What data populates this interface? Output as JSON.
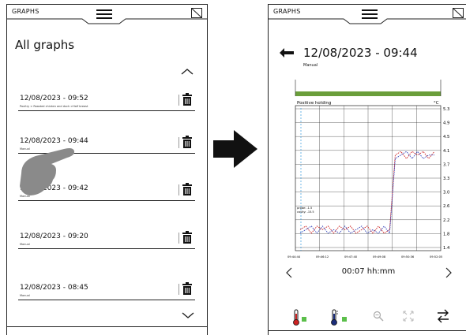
{
  "left_screen": {
    "header_label": "GRAPHS",
    "title": "All graphs",
    "entries": [
      {
        "date": "12/08/2023 - 09:52",
        "sub": "Poultry > Roasted chicken and duck >Half breast"
      },
      {
        "date": "12/08/2023 - 09:44",
        "sub": "Manual"
      },
      {
        "date": "12/08/2023 - 09:42",
        "sub": "Manual"
      },
      {
        "date": "12/08/2023 - 09:20",
        "sub": "Manual"
      },
      {
        "date": "12/08/2023 - 08:45",
        "sub": "Manual"
      }
    ],
    "icons": [
      "menu-icon",
      "corner-icon",
      "chevron-up-icon",
      "trash-icon",
      "chevron-down-icon",
      "hand-pointer-icon"
    ]
  },
  "right_screen": {
    "header_label": "GRAPHS",
    "title": "12/08/2023 - 09:44",
    "subtitle": "Manual",
    "duration": "00:07 hh:mm",
    "icons": [
      "back-arrow-icon",
      "chevron-left-icon",
      "chevron-right-icon",
      "probe-red-icon",
      "probe-blue-icon",
      "zoom-out-icon",
      "expand-icon",
      "swap-icon"
    ]
  },
  "transition_icon": "arrow-right-icon",
  "chart_data": {
    "type": "line",
    "phase_label": "Positive holding",
    "unit": "°C",
    "y_ticks": [
      "5.3",
      "4.9",
      "4.5",
      "4.1",
      "3.7",
      "3.3",
      "3.0",
      "2.6",
      "2.2",
      "1.8",
      "1.4"
    ],
    "x_ticks": [
      "09:44:44",
      "09:46:12",
      "09:47:40",
      "09:49:08",
      "09:50:36",
      "09:52:05"
    ],
    "annotation_lines": [
      "probe: -1.5",
      "cavity: -15.5"
    ],
    "ylim": [
      1.4,
      5.3
    ],
    "series": [
      {
        "values": [
          1.9,
          2.0,
          1.8,
          2.0,
          1.9,
          2.0,
          1.8,
          2.0,
          1.9,
          2.0,
          1.8,
          1.9,
          2.0,
          1.8,
          2.0,
          1.8,
          1.9,
          4.0,
          4.1,
          3.9,
          4.1,
          4.0,
          4.1,
          3.9,
          4.1
        ],
        "color": "#cc2222"
      },
      {
        "values": [
          1.8,
          1.9,
          2.0,
          1.8,
          2.0,
          1.8,
          1.9,
          1.8,
          2.0,
          1.8,
          1.9,
          2.0,
          1.8,
          1.9,
          1.8,
          2.0,
          1.8,
          3.9,
          4.0,
          4.1,
          3.9,
          4.1,
          3.9,
          4.0,
          4.0
        ],
        "color": "#3344bb"
      }
    ],
    "phase_bar_color": "#6a9e3a"
  }
}
